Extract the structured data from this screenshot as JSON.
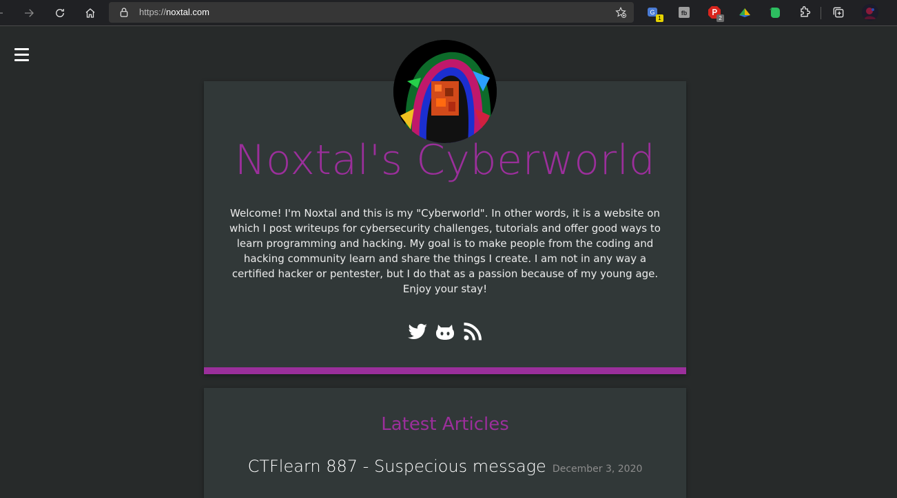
{
  "browser": {
    "url_scheme": "https://",
    "url_host": "noxtal.com",
    "extensions": [
      {
        "name": "translate-extension",
        "badge": "1",
        "color": "#4a7bd4",
        "badge_color": "#e6d300"
      },
      {
        "name": "fb-extension",
        "badge": "",
        "color": "#b0b0b0",
        "badge_color": ""
      },
      {
        "name": "adblock-extension",
        "badge": "2",
        "color": "#d9251d",
        "badge_color": "#6b6b6b"
      },
      {
        "name": "color-extension",
        "badge": "",
        "color": "#2fa84f",
        "badge_color": ""
      },
      {
        "name": "evernote-extension",
        "badge": "",
        "color": "#2dbe60",
        "badge_color": ""
      }
    ]
  },
  "site": {
    "title": "Noxtal's Cyberworld",
    "intro": "Welcome! I'm Noxtal and this is my \"Cyberworld\". In other words, it is a website on which I post writeups for cybersecurity challenges, tutorials and offer good ways to learn programming and hacking. My goal is to make people from the coding and hacking community learn and share the things I create. I am not in any way a certified hacker or pentester, but I do that as a passion because of my young age. Enjoy your stay!",
    "socials": [
      "twitter-icon",
      "github-icon",
      "rss-icon"
    ],
    "accent_color": "#9b2f9b"
  },
  "articles": {
    "heading": "Latest Articles",
    "items": [
      {
        "title": "CTFlearn 887 - Suspecious message",
        "date": "December 3, 2020"
      }
    ]
  }
}
